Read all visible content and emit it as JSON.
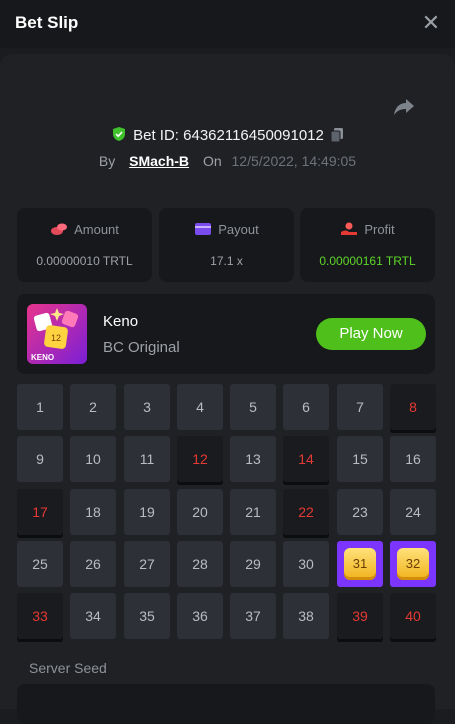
{
  "header": {
    "title": "Bet Slip",
    "close_icon": "close-icon"
  },
  "bet": {
    "id_label": "Bet ID: 64362116450091012",
    "by_label": "By",
    "user": "SMach-B",
    "on_label": "On",
    "date": "12/5/2022, 14:49:05"
  },
  "stats": {
    "amount": {
      "label": "Amount",
      "value": "0.00000010 TRTL",
      "icon": "coins-icon"
    },
    "payout": {
      "label": "Payout",
      "value": "17.1 x",
      "icon": "wallet-icon"
    },
    "profit": {
      "label": "Profit",
      "value": "0.00000161 TRTL",
      "icon": "hand-coin-icon"
    }
  },
  "game": {
    "name": "Keno",
    "subtitle": "BC Original",
    "play_label": "Play Now",
    "thumb_badge": "12",
    "thumb_label": "KENO"
  },
  "grid": {
    "numbers": [
      "1",
      "2",
      "3",
      "4",
      "5",
      "6",
      "7",
      "8",
      "9",
      "10",
      "11",
      "12",
      "13",
      "14",
      "15",
      "16",
      "17",
      "18",
      "19",
      "20",
      "21",
      "22",
      "23",
      "24",
      "25",
      "26",
      "27",
      "28",
      "29",
      "30",
      "31",
      "32",
      "33",
      "34",
      "35",
      "36",
      "37",
      "38",
      "39",
      "40"
    ],
    "selected_miss": [
      "8",
      "12",
      "14",
      "17",
      "22",
      "33",
      "39",
      "40"
    ],
    "selected_hit": [
      "31",
      "32"
    ]
  },
  "seed": {
    "label": "Server Seed"
  },
  "colors": {
    "accent_green": "#4fbf1c",
    "miss_red": "#e53935",
    "hit_purple": "#7b35ff",
    "gold": "#f0b21a"
  }
}
